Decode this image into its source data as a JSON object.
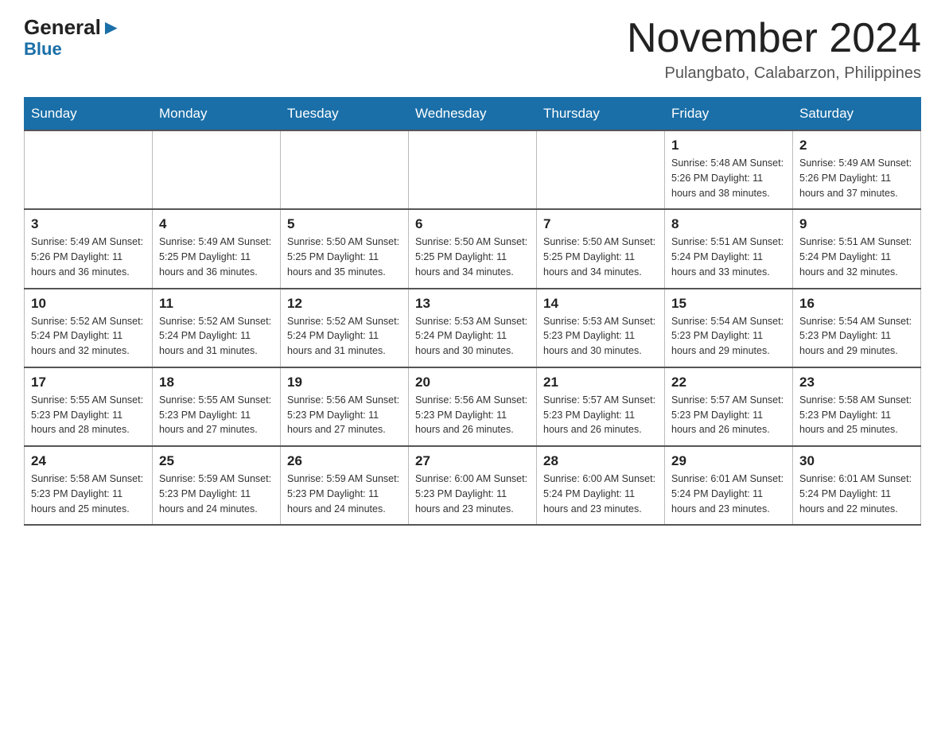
{
  "logo": {
    "general": "General",
    "blue": "Blue"
  },
  "title": {
    "month": "November 2024",
    "location": "Pulangbato, Calabarzon, Philippines"
  },
  "days_of_week": [
    "Sunday",
    "Monday",
    "Tuesday",
    "Wednesday",
    "Thursday",
    "Friday",
    "Saturday"
  ],
  "weeks": [
    [
      {
        "day": "",
        "info": ""
      },
      {
        "day": "",
        "info": ""
      },
      {
        "day": "",
        "info": ""
      },
      {
        "day": "",
        "info": ""
      },
      {
        "day": "",
        "info": ""
      },
      {
        "day": "1",
        "info": "Sunrise: 5:48 AM\nSunset: 5:26 PM\nDaylight: 11 hours and 38 minutes."
      },
      {
        "day": "2",
        "info": "Sunrise: 5:49 AM\nSunset: 5:26 PM\nDaylight: 11 hours and 37 minutes."
      }
    ],
    [
      {
        "day": "3",
        "info": "Sunrise: 5:49 AM\nSunset: 5:26 PM\nDaylight: 11 hours and 36 minutes."
      },
      {
        "day": "4",
        "info": "Sunrise: 5:49 AM\nSunset: 5:25 PM\nDaylight: 11 hours and 36 minutes."
      },
      {
        "day": "5",
        "info": "Sunrise: 5:50 AM\nSunset: 5:25 PM\nDaylight: 11 hours and 35 minutes."
      },
      {
        "day": "6",
        "info": "Sunrise: 5:50 AM\nSunset: 5:25 PM\nDaylight: 11 hours and 34 minutes."
      },
      {
        "day": "7",
        "info": "Sunrise: 5:50 AM\nSunset: 5:25 PM\nDaylight: 11 hours and 34 minutes."
      },
      {
        "day": "8",
        "info": "Sunrise: 5:51 AM\nSunset: 5:24 PM\nDaylight: 11 hours and 33 minutes."
      },
      {
        "day": "9",
        "info": "Sunrise: 5:51 AM\nSunset: 5:24 PM\nDaylight: 11 hours and 32 minutes."
      }
    ],
    [
      {
        "day": "10",
        "info": "Sunrise: 5:52 AM\nSunset: 5:24 PM\nDaylight: 11 hours and 32 minutes."
      },
      {
        "day": "11",
        "info": "Sunrise: 5:52 AM\nSunset: 5:24 PM\nDaylight: 11 hours and 31 minutes."
      },
      {
        "day": "12",
        "info": "Sunrise: 5:52 AM\nSunset: 5:24 PM\nDaylight: 11 hours and 31 minutes."
      },
      {
        "day": "13",
        "info": "Sunrise: 5:53 AM\nSunset: 5:24 PM\nDaylight: 11 hours and 30 minutes."
      },
      {
        "day": "14",
        "info": "Sunrise: 5:53 AM\nSunset: 5:23 PM\nDaylight: 11 hours and 30 minutes."
      },
      {
        "day": "15",
        "info": "Sunrise: 5:54 AM\nSunset: 5:23 PM\nDaylight: 11 hours and 29 minutes."
      },
      {
        "day": "16",
        "info": "Sunrise: 5:54 AM\nSunset: 5:23 PM\nDaylight: 11 hours and 29 minutes."
      }
    ],
    [
      {
        "day": "17",
        "info": "Sunrise: 5:55 AM\nSunset: 5:23 PM\nDaylight: 11 hours and 28 minutes."
      },
      {
        "day": "18",
        "info": "Sunrise: 5:55 AM\nSunset: 5:23 PM\nDaylight: 11 hours and 27 minutes."
      },
      {
        "day": "19",
        "info": "Sunrise: 5:56 AM\nSunset: 5:23 PM\nDaylight: 11 hours and 27 minutes."
      },
      {
        "day": "20",
        "info": "Sunrise: 5:56 AM\nSunset: 5:23 PM\nDaylight: 11 hours and 26 minutes."
      },
      {
        "day": "21",
        "info": "Sunrise: 5:57 AM\nSunset: 5:23 PM\nDaylight: 11 hours and 26 minutes."
      },
      {
        "day": "22",
        "info": "Sunrise: 5:57 AM\nSunset: 5:23 PM\nDaylight: 11 hours and 26 minutes."
      },
      {
        "day": "23",
        "info": "Sunrise: 5:58 AM\nSunset: 5:23 PM\nDaylight: 11 hours and 25 minutes."
      }
    ],
    [
      {
        "day": "24",
        "info": "Sunrise: 5:58 AM\nSunset: 5:23 PM\nDaylight: 11 hours and 25 minutes."
      },
      {
        "day": "25",
        "info": "Sunrise: 5:59 AM\nSunset: 5:23 PM\nDaylight: 11 hours and 24 minutes."
      },
      {
        "day": "26",
        "info": "Sunrise: 5:59 AM\nSunset: 5:23 PM\nDaylight: 11 hours and 24 minutes."
      },
      {
        "day": "27",
        "info": "Sunrise: 6:00 AM\nSunset: 5:23 PM\nDaylight: 11 hours and 23 minutes."
      },
      {
        "day": "28",
        "info": "Sunrise: 6:00 AM\nSunset: 5:24 PM\nDaylight: 11 hours and 23 minutes."
      },
      {
        "day": "29",
        "info": "Sunrise: 6:01 AM\nSunset: 5:24 PM\nDaylight: 11 hours and 23 minutes."
      },
      {
        "day": "30",
        "info": "Sunrise: 6:01 AM\nSunset: 5:24 PM\nDaylight: 11 hours and 22 minutes."
      }
    ]
  ]
}
